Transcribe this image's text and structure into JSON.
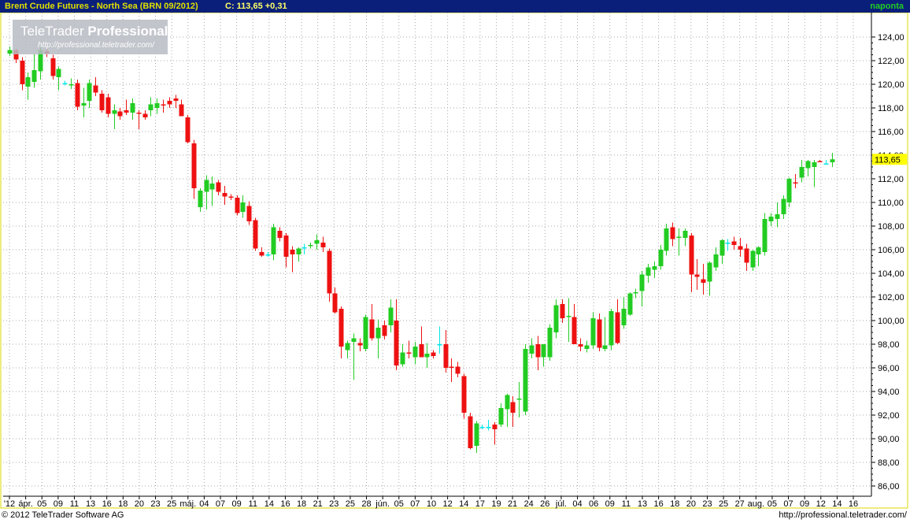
{
  "header": {
    "title": "Brent Crude Futures - North Sea (BRN 09/2012)",
    "close_text": "C: 113,65 +0,31",
    "period": "naponta"
  },
  "watermark": {
    "brand_plain": "TeleTrader ",
    "brand_bold": "Professional",
    "url": "http://professional.teletrader.com/"
  },
  "footer": {
    "copyright": "© 2012 TeleTrader Software AG",
    "url": "http://professional.teletrader.com/"
  },
  "colors": {
    "background": "#ffffff",
    "title_bar": "#0a1f7a",
    "up": "#22cc22",
    "down": "#ee1111",
    "doji": "#00e5e5",
    "last_price_badge": "#ffff00",
    "axis_frame": "#d8d800"
  },
  "chart_data": {
    "type": "candlestick",
    "y_axis": {
      "side": "right",
      "min": 85,
      "max": 125,
      "ticks": [
        "86,00",
        "88,00",
        "90,00",
        "92,00",
        "94,00",
        "96,00",
        "98,00",
        "100,00",
        "102,00",
        "104,00",
        "106,00",
        "108,00",
        "110,00",
        "112,00",
        "114,00",
        "116,00",
        "118,00",
        "120,00",
        "122,00",
        "124,00"
      ]
    },
    "last_price_label": "113,65",
    "x_tick_labels": [
      "'12",
      "ápr.",
      "05",
      "09",
      "11",
      "13",
      "16",
      "18",
      "20",
      "23",
      "25",
      "máj.",
      "04",
      "07",
      "09",
      "11",
      "14",
      "16",
      "18",
      "21",
      "23",
      "25",
      "28",
      "jún.",
      "05",
      "07",
      "10",
      "12",
      "14",
      "17",
      "19",
      "21",
      "24",
      "26",
      "júl.",
      "04",
      "06",
      "09",
      "11",
      "13",
      "16",
      "18",
      "20",
      "23",
      "25",
      "27",
      "aug.",
      "05",
      "07",
      "09",
      "12",
      "14",
      "16"
    ],
    "grid": "dotted",
    "candles": [
      [
        122.6,
        123.2,
        122.4,
        122.9
      ],
      [
        122.9,
        123.0,
        121.8,
        122.1
      ],
      [
        122.0,
        122.3,
        119.5,
        120.0
      ],
      [
        119.8,
        121.0,
        118.7,
        120.6
      ],
      [
        120.2,
        122.6,
        119.7,
        121.2
      ],
      [
        121.1,
        123.2,
        120.4,
        122.9
      ],
      [
        122.8,
        123.0,
        122.3,
        122.6
      ],
      [
        122.2,
        122.5,
        120.4,
        120.7
      ],
      [
        120.6,
        121.5,
        119.5,
        121.3
      ],
      [
        120.1,
        120.3,
        119.9,
        120.1
      ],
      [
        119.9,
        120.5,
        119.6,
        120.0
      ],
      [
        120.1,
        120.4,
        117.8,
        118.1
      ],
      [
        118.2,
        119.7,
        117.2,
        118.4
      ],
      [
        118.6,
        120.4,
        118.0,
        120.1
      ],
      [
        119.9,
        120.6,
        119.0,
        119.3
      ],
      [
        119.2,
        119.5,
        117.6,
        117.8
      ],
      [
        118.9,
        119.2,
        117.2,
        117.5
      ],
      [
        117.5,
        118.3,
        116.2,
        117.8
      ],
      [
        117.7,
        118.0,
        117.0,
        117.3
      ],
      [
        117.8,
        118.7,
        117.4,
        117.6
      ],
      [
        117.6,
        118.8,
        117.0,
        118.4
      ],
      [
        117.6,
        117.8,
        116.2,
        117.5
      ],
      [
        117.5,
        117.8,
        117.0,
        117.2
      ],
      [
        117.8,
        118.9,
        117.3,
        118.3
      ],
      [
        118.0,
        118.8,
        117.5,
        118.4
      ],
      [
        118.3,
        118.7,
        117.6,
        118.2
      ],
      [
        118.6,
        118.9,
        118.0,
        118.3
      ],
      [
        118.8,
        119.1,
        118.0,
        118.6
      ],
      [
        118.3,
        118.7,
        117.3,
        117.3
      ],
      [
        117.2,
        117.4,
        115.0,
        115.1
      ],
      [
        115.0,
        115.3,
        110.3,
        111.2
      ],
      [
        109.6,
        111.2,
        109.2,
        111.0
      ],
      [
        110.9,
        112.3,
        109.4,
        111.9
      ],
      [
        111.1,
        112.2,
        109.7,
        111.6
      ],
      [
        111.7,
        111.9,
        110.6,
        110.9
      ],
      [
        110.8,
        111.4,
        109.8,
        110.5
      ],
      [
        110.5,
        110.7,
        110.2,
        110.4
      ],
      [
        110.4,
        110.6,
        108.9,
        109.1
      ],
      [
        109.2,
        110.6,
        108.7,
        110.0
      ],
      [
        109.7,
        110.1,
        108.1,
        108.4
      ],
      [
        108.5,
        108.7,
        105.9,
        106.1
      ],
      [
        105.8,
        106.2,
        105.4,
        105.5
      ],
      [
        105.6,
        105.8,
        105.4,
        105.6
      ],
      [
        105.6,
        108.2,
        105.1,
        107.9
      ],
      [
        107.6,
        107.9,
        106.7,
        107.0
      ],
      [
        107.2,
        107.4,
        104.5,
        105.4
      ],
      [
        106.0,
        106.3,
        104.1,
        105.6
      ],
      [
        105.6,
        106.2,
        105.0,
        106.1
      ],
      [
        106.2,
        106.5,
        105.6,
        106.2
      ],
      [
        106.3,
        106.6,
        106.1,
        106.4
      ],
      [
        106.5,
        107.3,
        106.0,
        106.8
      ],
      [
        106.6,
        107.1,
        105.8,
        106.2
      ],
      [
        105.9,
        106.1,
        101.6,
        102.3
      ],
      [
        102.3,
        102.8,
        100.6,
        100.7
      ],
      [
        101.0,
        101.2,
        96.8,
        97.8
      ],
      [
        97.5,
        98.3,
        96.8,
        98.1
      ],
      [
        98.2,
        98.9,
        95.0,
        98.5
      ],
      [
        98.1,
        98.5,
        97.4,
        97.9
      ],
      [
        97.6,
        100.5,
        97.4,
        100.3
      ],
      [
        100.1,
        101.4,
        98.3,
        98.5
      ],
      [
        98.5,
        100.1,
        96.8,
        99.4
      ],
      [
        99.6,
        100.0,
        98.4,
        98.7
      ],
      [
        99.6,
        101.8,
        99.0,
        101.1
      ],
      [
        100.0,
        101.8,
        95.8,
        96.2
      ],
      [
        96.3,
        98.0,
        96.1,
        97.3
      ],
      [
        97.3,
        98.3,
        96.8,
        97.2
      ],
      [
        96.9,
        98.2,
        96.3,
        97.8
      ],
      [
        98.0,
        99.5,
        96.9,
        96.9
      ],
      [
        96.9,
        98.1,
        96.0,
        97.2
      ],
      [
        97.3,
        97.5,
        96.8,
        97.0
      ],
      [
        98.0,
        99.5,
        97.2,
        98.0
      ],
      [
        98.0,
        99.2,
        95.6,
        96.0
      ],
      [
        96.1,
        96.8,
        94.8,
        96.0
      ],
      [
        96.1,
        96.5,
        95.2,
        95.5
      ],
      [
        95.3,
        95.5,
        91.7,
        92.2
      ],
      [
        91.9,
        92.2,
        89.1,
        89.2
      ],
      [
        89.4,
        91.5,
        88.8,
        91.3
      ],
      [
        91.0,
        91.2,
        90.8,
        91.0
      ],
      [
        91.0,
        91.6,
        90.7,
        91.0
      ],
      [
        91.2,
        91.4,
        89.5,
        90.8
      ],
      [
        91.2,
        93.0,
        91.0,
        92.6
      ],
      [
        92.5,
        93.8,
        91.0,
        93.7
      ],
      [
        93.1,
        93.6,
        91.0,
        92.2
      ],
      [
        93.3,
        94.8,
        91.8,
        93.4
      ],
      [
        92.3,
        98.0,
        92.0,
        97.6
      ],
      [
        97.2,
        98.5,
        96.8,
        97.9
      ],
      [
        98.0,
        98.7,
        95.8,
        96.9
      ],
      [
        96.9,
        98.0,
        96.1,
        98.0
      ],
      [
        96.9,
        99.7,
        96.6,
        99.4
      ],
      [
        99.0,
        101.8,
        98.5,
        101.3
      ],
      [
        101.4,
        101.8,
        99.8,
        100.2
      ],
      [
        100.3,
        101.9,
        98.2,
        100.4
      ],
      [
        100.3,
        101.4,
        98.0,
        98.0
      ],
      [
        98.0,
        98.5,
        97.4,
        97.8
      ],
      [
        97.6,
        98.3,
        97.3,
        97.9
      ],
      [
        97.9,
        100.7,
        97.6,
        100.2
      ],
      [
        100.1,
        100.6,
        97.4,
        97.7
      ],
      [
        97.6,
        100.3,
        97.4,
        97.9
      ],
      [
        97.9,
        101.0,
        97.5,
        100.8
      ],
      [
        100.7,
        101.8,
        98.0,
        98.1
      ],
      [
        99.6,
        102.0,
        99.3,
        101.0
      ],
      [
        100.5,
        102.4,
        100.4,
        102.3
      ],
      [
        102.3,
        102.7,
        101.9,
        102.4
      ],
      [
        102.5,
        104.2,
        101.2,
        103.9
      ],
      [
        103.8,
        104.8,
        103.2,
        104.5
      ],
      [
        104.3,
        105.0,
        103.6,
        104.6
      ],
      [
        104.6,
        106.4,
        104.3,
        106.0
      ],
      [
        105.9,
        108.2,
        105.5,
        107.8
      ],
      [
        107.9,
        108.3,
        106.3,
        106.9
      ],
      [
        107.0,
        107.8,
        105.5,
        107.1
      ],
      [
        107.0,
        107.8,
        106.3,
        107.6
      ],
      [
        107.2,
        107.4,
        102.4,
        103.9
      ],
      [
        103.9,
        105.2,
        102.6,
        103.7
      ],
      [
        103.5,
        104.8,
        102.2,
        103.2
      ],
      [
        103.3,
        105.0,
        102.1,
        104.9
      ],
      [
        104.5,
        106.2,
        104.2,
        105.6
      ],
      [
        105.5,
        106.9,
        104.8,
        106.8
      ],
      [
        106.6,
        106.9,
        105.9,
        106.6
      ],
      [
        106.7,
        107.1,
        106.0,
        106.4
      ],
      [
        106.3,
        107.0,
        105.4,
        106.0
      ],
      [
        106.1,
        106.5,
        104.2,
        104.9
      ],
      [
        104.5,
        106.0,
        104.2,
        105.9
      ],
      [
        105.6,
        106.3,
        104.6,
        106.2
      ],
      [
        105.8,
        109.1,
        105.5,
        108.6
      ],
      [
        108.4,
        109.1,
        108.0,
        108.8
      ],
      [
        108.6,
        110.0,
        107.9,
        109.0
      ],
      [
        109.0,
        110.6,
        108.6,
        110.3
      ],
      [
        110.0,
        112.1,
        109.6,
        112.0
      ],
      [
        111.7,
        112.4,
        111.2,
        111.6
      ],
      [
        112.1,
        113.6,
        111.7,
        113.0
      ],
      [
        112.9,
        113.6,
        112.2,
        113.5
      ],
      [
        113.0,
        113.6,
        111.3,
        113.4
      ],
      [
        113.5,
        113.6,
        113.4,
        113.4
      ],
      [
        113.3,
        113.6,
        113.2,
        113.3
      ],
      [
        113.4,
        114.2,
        113.0,
        113.65
      ]
    ]
  }
}
